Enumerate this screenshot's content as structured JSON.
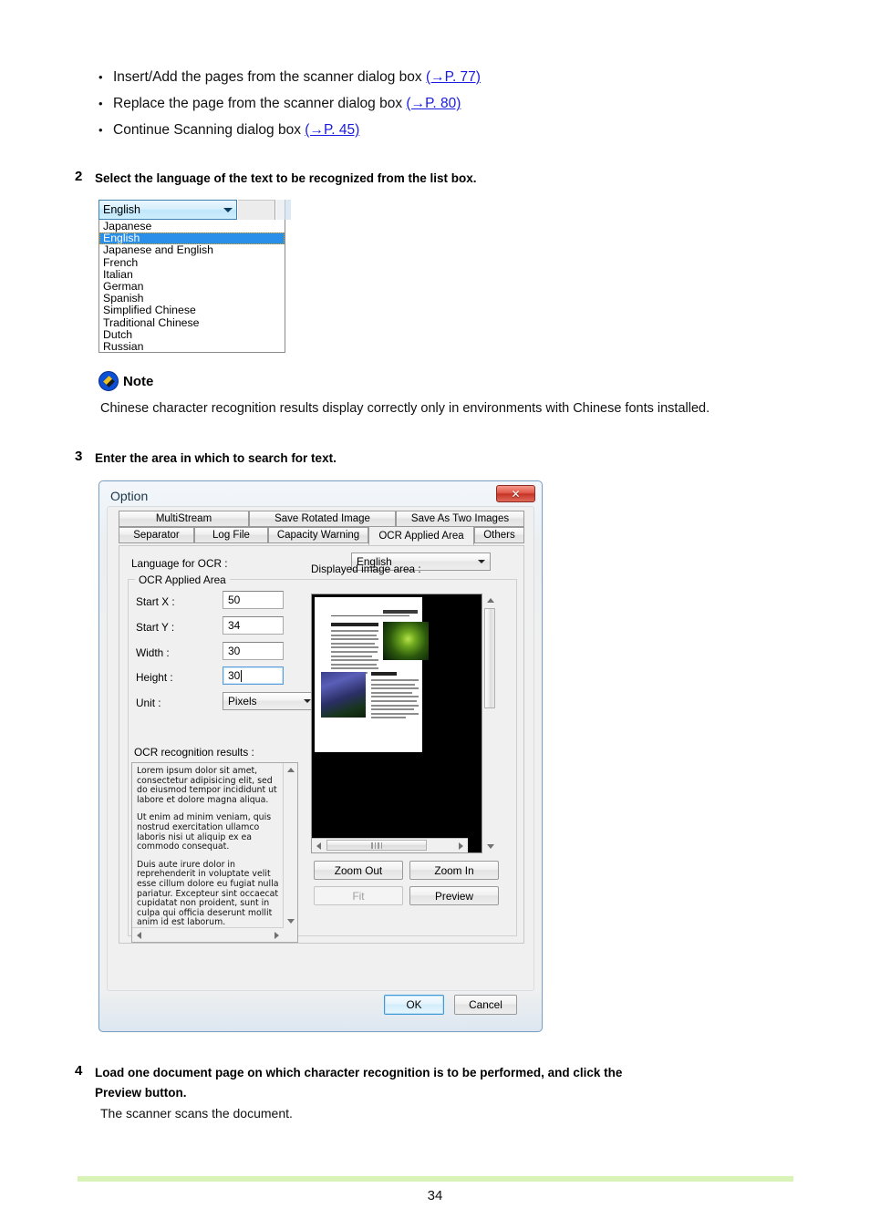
{
  "bullets": [
    {
      "text": "Insert/Add the pages from the scanner dialog box",
      "xref": "(→P. 77)"
    },
    {
      "text": "Replace the page from the scanner dialog box",
      "xref": "(→P. 80)"
    },
    {
      "text": "Continue Scanning dialog box",
      "xref": "(→P. 45)"
    }
  ],
  "steps": {
    "two": {
      "num": "2",
      "text": "Select the language of the text to be recognized from the list box."
    },
    "three": {
      "num": "3",
      "text": "Enter the area in which to search for text."
    },
    "four": {
      "num": "4",
      "line1": "Load one document page on which character recognition is to be performed, and click the",
      "line2": "Preview button.",
      "followup": "The scanner scans the document."
    }
  },
  "language_combo": {
    "selected": "English",
    "options": [
      "Japanese",
      "English",
      "Japanese and English",
      "French",
      "Italian",
      "German",
      "Spanish",
      "Simplified Chinese",
      "Traditional Chinese",
      "Dutch",
      "Russian"
    ],
    "highlighted_index": 1
  },
  "note": {
    "title": "Note",
    "body": "Chinese character recognition results display correctly only in environments with Chinese fonts installed."
  },
  "dialog": {
    "title": "Option",
    "close_label": "✕",
    "tabs_row1": [
      "MultiStream",
      "Save Rotated Image",
      "Save As Two Images"
    ],
    "tabs_row2": [
      "Separator",
      "Log File",
      "Capacity Warning",
      "OCR Applied Area",
      "Others"
    ],
    "active_tab": "OCR Applied Area",
    "language_label": "Language for OCR :",
    "language_value": "English",
    "group_caption": "OCR Applied Area",
    "fields": [
      {
        "label": "Start X :",
        "value": "50",
        "focused": false
      },
      {
        "label": "Start Y :",
        "value": "34",
        "focused": false
      },
      {
        "label": "Width :",
        "value": "30",
        "focused": false
      },
      {
        "label": "Height :",
        "value": "30",
        "focused": true
      }
    ],
    "unit_label": "Unit :",
    "unit_value": "Pixels",
    "results_label": "OCR recognition results :",
    "results_text": [
      "Lorem ipsum dolor sit amet, consectetur adipisicing elit, sed do eiusmod tempor incididunt ut labore et dolore magna aliqua.",
      "Ut enim ad minim veniam, quis nostrud exercitation ullamco laboris nisi ut aliquip ex ea commodo consequat.",
      "Duis aute irure dolor in reprehenderit in voluptate velit esse cillum dolore eu fugiat nulla pariatur. Excepteur sint occaecat cupidatat non proident, sunt in culpa qui officia deserunt mollit anim id est laborum."
    ],
    "image_area_label": "Displayed image area :",
    "zoom_out_label": "Zoom Out",
    "zoom_in_label": "Zoom In",
    "fit_label": "Fit",
    "preview_label": "Preview",
    "ok_label": "OK",
    "cancel_label": "Cancel"
  },
  "footer": {
    "page_number": "34"
  },
  "colors": {
    "link": "#1a1ae0",
    "highlight": "#2a8fe8",
    "footer_rule": "#d8f2b8",
    "close_button": "#c53426"
  }
}
